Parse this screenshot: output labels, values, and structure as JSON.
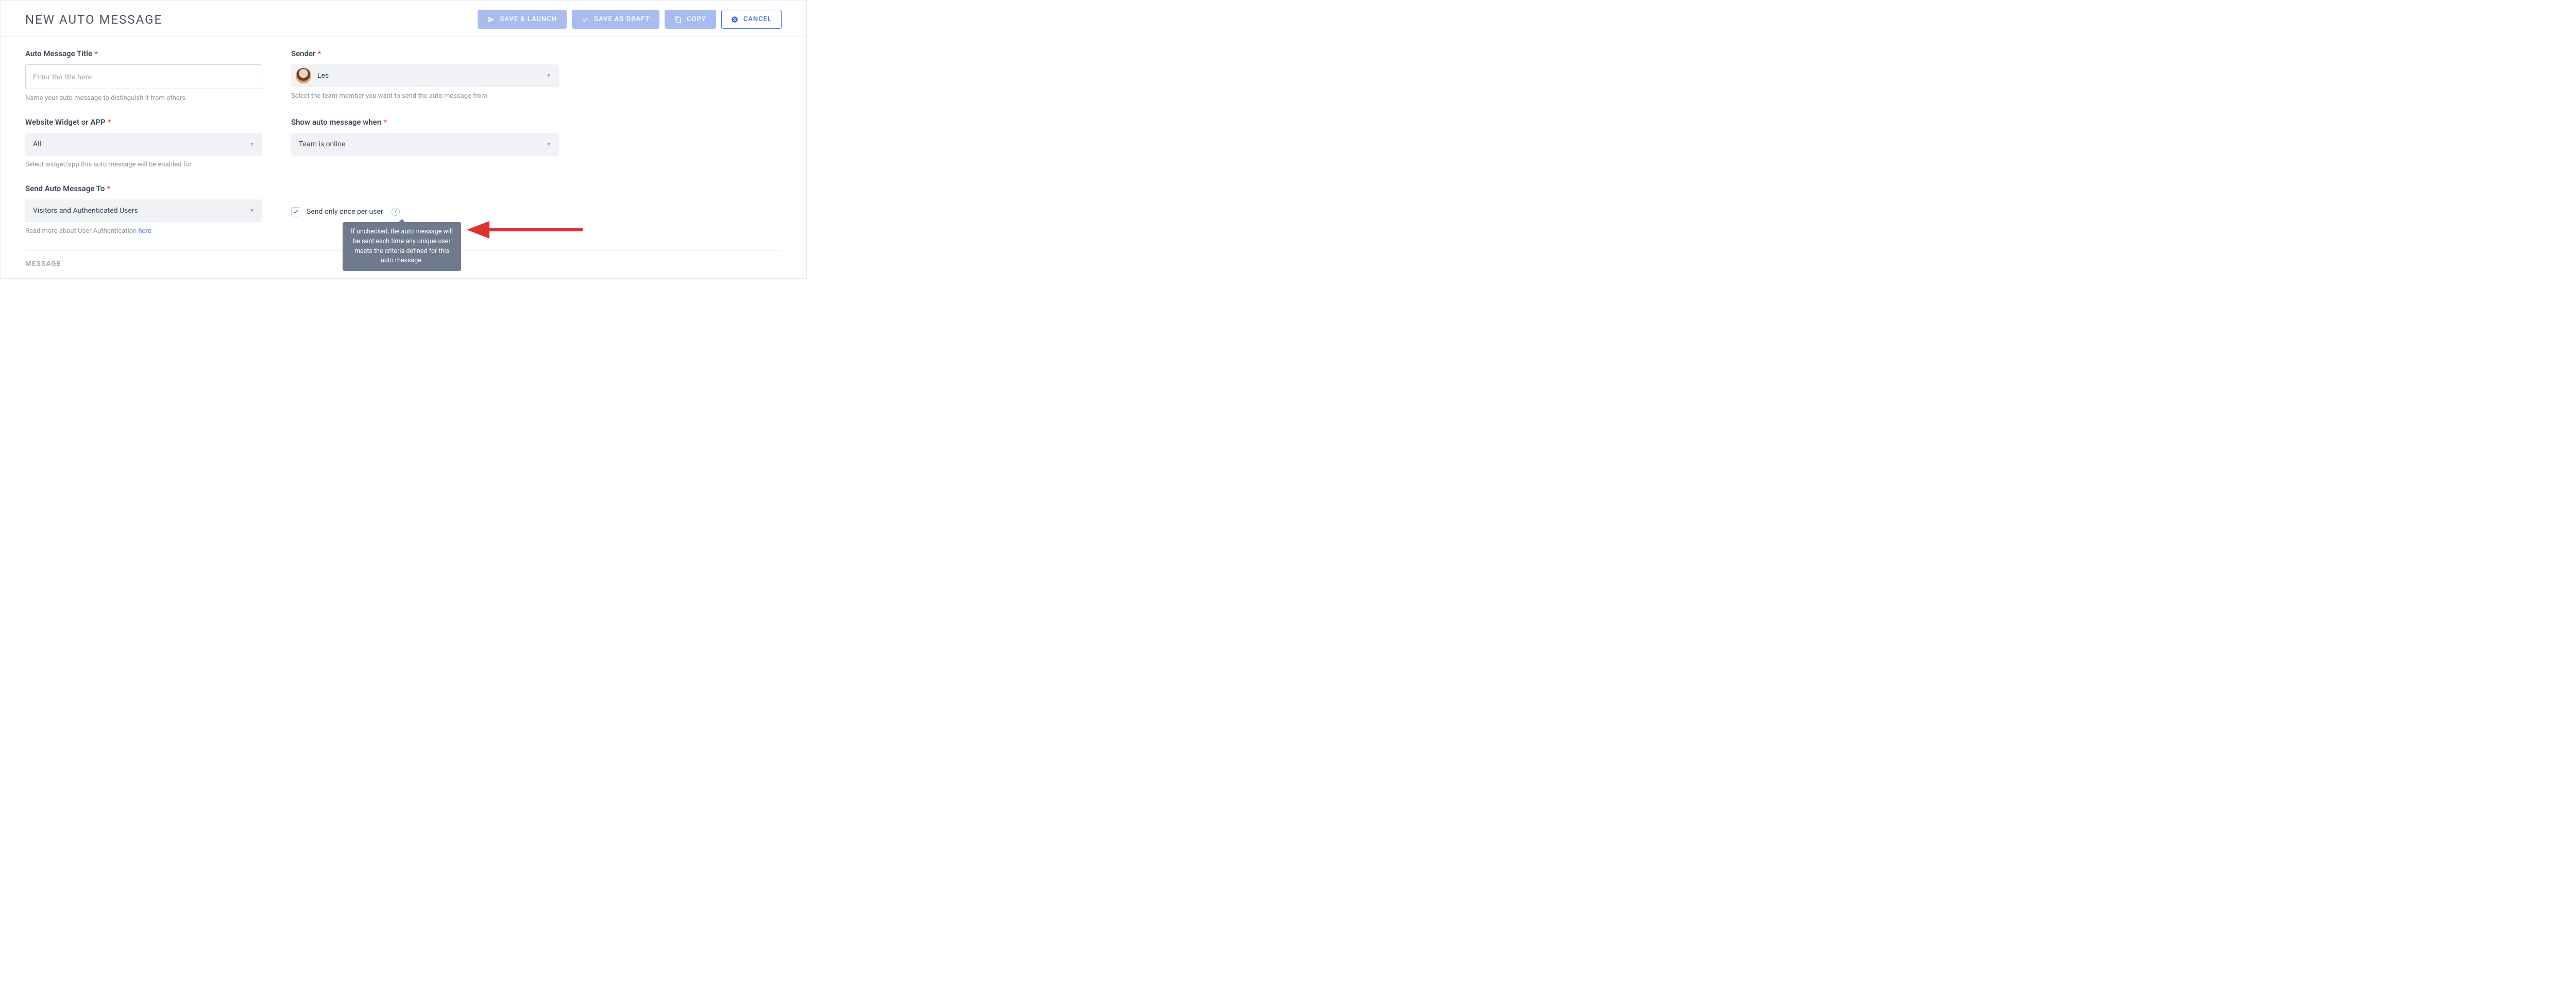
{
  "header": {
    "title": "NEW AUTO MESSAGE",
    "buttons": {
      "save_launch": "SAVE & LAUNCH",
      "save_draft": "SAVE AS DRAFT",
      "copy": "COPY",
      "cancel": "CANCEL"
    }
  },
  "fields": {
    "title": {
      "label": "Auto Message Title",
      "placeholder": "Enter the title here",
      "value": "",
      "help": "Name your auto message to distinguish it from others"
    },
    "sender": {
      "label": "Sender",
      "value": "Les",
      "help": "Select the team member you want to send the auto message from"
    },
    "widget": {
      "label": "Website Widget or APP",
      "value": "All",
      "help": "Select widget/app this auto message will be enabled for"
    },
    "show_when": {
      "label": "Show auto message when",
      "value": "Team is online"
    },
    "send_to": {
      "label": "Send Auto Message To",
      "value": "Visitors and Authenticated Users",
      "help_prefix": "Read more about User Authentication ",
      "help_link": "here"
    },
    "send_once": {
      "label": "Send only once per user",
      "checked": true,
      "tooltip": "If unchecked, the auto message will be sent each time any unique user meets the criteria defined for this auto message."
    }
  },
  "sections": {
    "message": "MESSAGE"
  }
}
